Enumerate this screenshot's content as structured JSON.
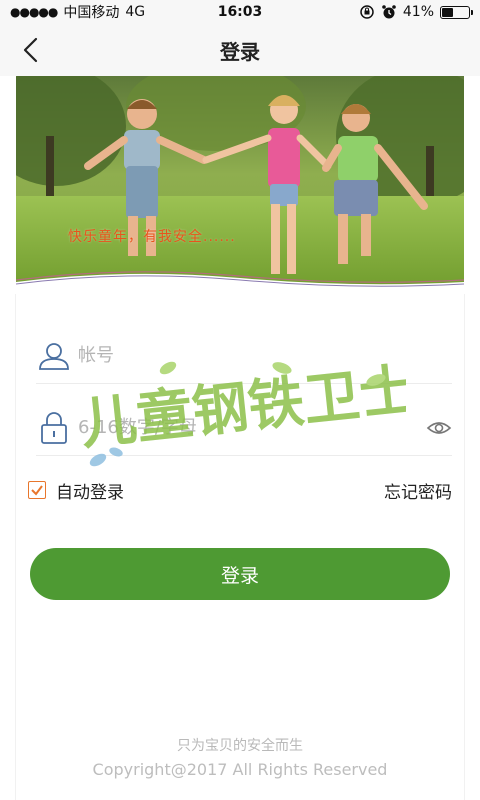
{
  "status_bar": {
    "signal_dots": "●●●●●",
    "carrier": "中国移动",
    "network": "4G",
    "time": "16:03",
    "battery_percent": "41%",
    "battery_level": 0.41
  },
  "nav": {
    "title": "登录"
  },
  "hero": {
    "caption": "快乐童年，有我安全......"
  },
  "form": {
    "account_placeholder": "帐号",
    "password_placeholder": "6-16数字/字母"
  },
  "watermark": {
    "text": "儿童钢铁卫士"
  },
  "options": {
    "remember_label": "自动登录",
    "remember_checked": true,
    "forgot_label": "忘记密码"
  },
  "login_button": {
    "label": "登录",
    "color": "#4e9a33"
  },
  "footer": {
    "slogan": "只为宝贝的安全而生",
    "copyright": "Copyright@2017 All Rights Reserved"
  },
  "colors": {
    "accent": "#4e9a33",
    "checkbox": "#e8762c",
    "caption": "#e8541c"
  }
}
